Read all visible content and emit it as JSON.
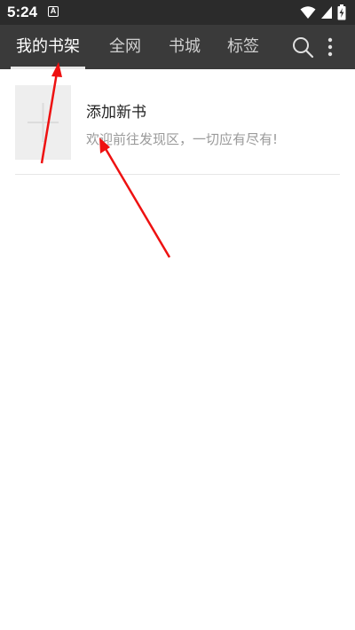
{
  "status_bar": {
    "time": "5:24",
    "notification_letter": "A",
    "icons": [
      "wifi-icon",
      "signal-icon",
      "battery-charging-icon"
    ]
  },
  "toolbar": {
    "tabs": [
      {
        "label": "我的书架",
        "active": true
      },
      {
        "label": "全网",
        "active": false
      },
      {
        "label": "书城",
        "active": false
      },
      {
        "label": "标签",
        "active": false
      }
    ],
    "actions": [
      "search-icon",
      "more-vertical-icon"
    ]
  },
  "bookshelf": {
    "items": [
      {
        "title": "添加新书",
        "description": "欢迎前往发现区，一切应有尽有!",
        "cover_icon": "plus-icon"
      }
    ]
  },
  "colors": {
    "status_bar": "#2b2b2b",
    "toolbar": "#3a3a3a",
    "annotation_arrow": "#ee1111",
    "cover_placeholder": "#eeeeee"
  }
}
